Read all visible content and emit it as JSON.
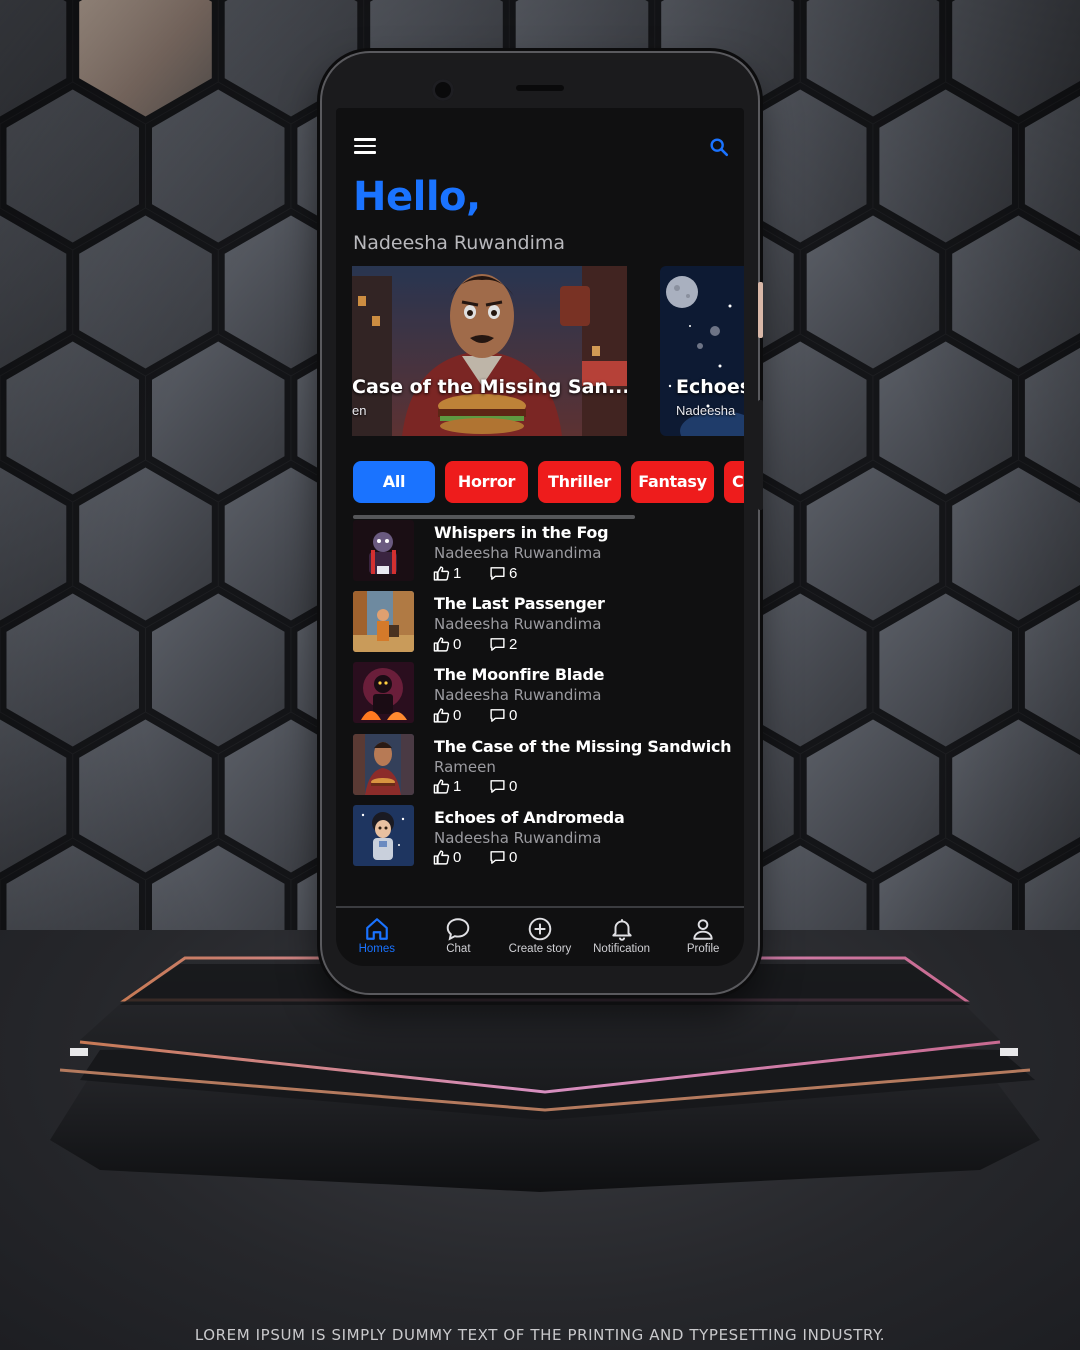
{
  "colors": {
    "accent": "#1a73ff",
    "chip": "#ee1c1c",
    "screen": "#101011"
  },
  "header": {
    "greeting": "Hello,",
    "user_name": "Nadeesha Ruwandima"
  },
  "carousel": [
    {
      "title": "Case of the Missing San...",
      "author": "en"
    },
    {
      "title": "Echoes",
      "author": "Nadeesha"
    }
  ],
  "categories": [
    {
      "label": "All",
      "active": true
    },
    {
      "label": "Horror"
    },
    {
      "label": "Thriller"
    },
    {
      "label": "Fantasy"
    },
    {
      "label": "C"
    }
  ],
  "stories": [
    {
      "title": "Whispers in the Fog",
      "author": "Nadeesha Ruwandima",
      "likes": "1",
      "comments": "6"
    },
    {
      "title": "The Last Passenger",
      "author": "Nadeesha Ruwandima",
      "likes": "0",
      "comments": "2"
    },
    {
      "title": "The Moonfire Blade",
      "author": "Nadeesha Ruwandima",
      "likes": "0",
      "comments": "0"
    },
    {
      "title": "The Case of the Missing Sandwich",
      "author": "Rameen",
      "likes": "1",
      "comments": "0"
    },
    {
      "title": "Echoes of Andromeda",
      "author": "Nadeesha Ruwandima",
      "likes": "0",
      "comments": "0"
    }
  ],
  "nav": [
    {
      "label": "Homes",
      "icon": "home-icon",
      "active": true
    },
    {
      "label": "Chat",
      "icon": "chat-icon"
    },
    {
      "label": "Create story",
      "icon": "plus-circle-icon"
    },
    {
      "label": "Notification",
      "icon": "bell-icon"
    },
    {
      "label": "Profile",
      "icon": "person-icon"
    }
  ],
  "footer": {
    "caption": "LOREM IPSUM IS SIMPLY DUMMY TEXT OF THE PRINTING AND TYPESETTING INDUSTRY."
  }
}
